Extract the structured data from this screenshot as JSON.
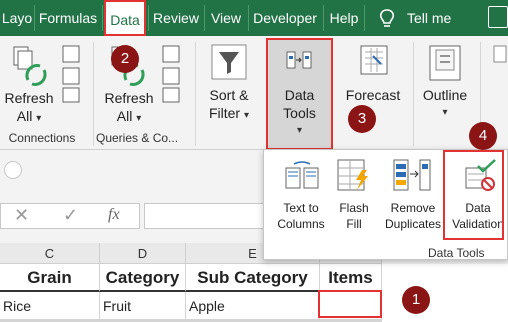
{
  "menu": {
    "tabs": [
      "Layo",
      "Formulas",
      "Data",
      "Review",
      "View",
      "Developer",
      "Help"
    ],
    "tell_me": "Tell me"
  },
  "ribbon": {
    "refresh1": "Refresh",
    "refresh1_sub": "All",
    "refresh2": "Refresh",
    "refresh2_sub": "All",
    "sort": "Sort &",
    "filter": "Filter",
    "data_tools_1": "Data",
    "data_tools_2": "Tools",
    "forecast": "Forecast",
    "outline": "Outline",
    "group_connections": "Connections",
    "group_queries": "Queries & Co..."
  },
  "dropdown": {
    "text_to_columns_1": "Text to",
    "text_to_columns_2": "Columns",
    "flash_fill_1": "Flash",
    "flash_fill_2": "Fill",
    "remove_dup_1": "Remove",
    "remove_dup_2": "Duplicates",
    "data_validation_1": "Data",
    "data_validation_2": "Validation",
    "group_label": "Data Tools"
  },
  "formula_bar": {
    "fx": "fx"
  },
  "columns": [
    "C",
    "D",
    "E"
  ],
  "table": {
    "headers": [
      "Grain",
      "Category",
      "Sub Category",
      "Items"
    ],
    "row1": [
      "Rice",
      "Fruit",
      "Apple",
      ""
    ]
  },
  "callouts": [
    "1",
    "2",
    "3",
    "4"
  ],
  "colors": {
    "accent": "#217346",
    "callout": "#8b1414",
    "highlight": "#e23232"
  }
}
